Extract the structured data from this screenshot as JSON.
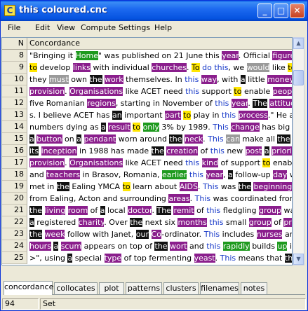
{
  "window": {
    "title": "this coloured.cnc",
    "app_icon_letter": "C"
  },
  "titlebar_buttons": {
    "minimize": "_",
    "maximize": "□",
    "close": "✕"
  },
  "menu": [
    "File",
    "Edit",
    "View",
    "Compute",
    "Settings",
    "Help"
  ],
  "grid": {
    "col_n": "N",
    "col_c": "Concordance",
    "rows": [
      {
        "n": "8",
        "segs": [
          [
            "t",
            "\"Bringing it "
          ],
          [
            "green",
            "Home"
          ],
          [
            "t",
            "\" was published on 21 June this "
          ],
          [
            "purple",
            "year"
          ],
          [
            "t",
            ". Official "
          ],
          [
            "purple",
            "figures"
          ],
          [
            "t",
            " sug"
          ]
        ]
      },
      {
        "n": "9",
        "segs": [
          [
            "yellow",
            "to"
          ],
          [
            "t",
            " develop "
          ],
          [
            "purple",
            "links"
          ],
          [
            "t",
            " with individual "
          ],
          [
            "purple",
            "churches"
          ],
          [
            "t",
            ". "
          ],
          [
            "yellow",
            "To"
          ],
          [
            "t",
            " "
          ],
          [
            "blue",
            "do this"
          ],
          [
            "t",
            ", we "
          ],
          [
            "gray",
            "would"
          ],
          [
            "t",
            " like "
          ],
          [
            "yellow",
            "to"
          ],
          [
            "t",
            " recruit"
          ]
        ]
      },
      {
        "n": "10",
        "segs": [
          [
            "t",
            "they "
          ],
          [
            "gray",
            "must"
          ],
          [
            "t",
            " own "
          ],
          [
            "black",
            "the"
          ],
          [
            "t",
            " "
          ],
          [
            "purple",
            "work"
          ],
          [
            "t",
            " themselves. In "
          ],
          [
            "blue",
            "this"
          ],
          [
            "t",
            " "
          ],
          [
            "purple",
            "way"
          ],
          [
            "t",
            ", with "
          ],
          [
            "black",
            "a"
          ],
          [
            "t",
            " little "
          ],
          [
            "purple",
            "money"
          ]
        ]
      },
      {
        "n": "11",
        "segs": [
          [
            "purple",
            "provision"
          ],
          [
            "t",
            ". "
          ],
          [
            "purple",
            "Organisations"
          ],
          [
            "t",
            " like ACET need "
          ],
          [
            "blue",
            "this"
          ],
          [
            "t",
            " support "
          ],
          [
            "yellow",
            "to"
          ],
          [
            "t",
            " enable "
          ],
          [
            "purple",
            "people"
          ]
        ]
      },
      {
        "n": "12",
        "segs": [
          [
            "t",
            "five Romanian "
          ],
          [
            "purple",
            "regions"
          ],
          [
            "t",
            ", starting in November of "
          ],
          [
            "blue",
            "this"
          ],
          [
            "t",
            " "
          ],
          [
            "purple",
            "year"
          ],
          [
            "t",
            ". "
          ],
          [
            "black",
            "The"
          ],
          [
            "t",
            " "
          ],
          [
            "purple",
            "attitude"
          ],
          [
            "t",
            " of man"
          ]
        ]
      },
      {
        "n": "13",
        "segs": [
          [
            "t",
            "s. I believe ACET has "
          ],
          [
            "black",
            "an"
          ],
          [
            "t",
            " important "
          ],
          [
            "purple",
            "part"
          ],
          [
            "t",
            " "
          ],
          [
            "yellow",
            "to"
          ],
          [
            "t",
            " play in "
          ],
          [
            "blue",
            "this"
          ],
          [
            "t",
            " "
          ],
          [
            "purple",
            "process"
          ],
          [
            "t",
            ".\" He added, \"W"
          ]
        ]
      },
      {
        "n": "14",
        "segs": [
          [
            "t",
            "numbers dying as "
          ],
          [
            "black",
            "a"
          ],
          [
            "t",
            " "
          ],
          [
            "purple",
            "result"
          ],
          [
            "t",
            " "
          ],
          [
            "yellow",
            "to"
          ],
          [
            "t",
            " "
          ],
          [
            "green",
            "only"
          ],
          [
            "t",
            " 3% by 1989. "
          ],
          [
            "blue",
            "This"
          ],
          [
            "t",
            " "
          ],
          [
            "purple",
            "change"
          ],
          [
            "t",
            " has big "
          ],
          [
            "purple",
            "implicati"
          ]
        ]
      },
      {
        "n": "15",
        "segs": [
          [
            "black",
            "a"
          ],
          [
            "t",
            " "
          ],
          [
            "purple",
            "button"
          ],
          [
            "t",
            " on "
          ],
          [
            "black",
            "a"
          ],
          [
            "t",
            " "
          ],
          [
            "purple",
            "pendant"
          ],
          [
            "t",
            " worn around "
          ],
          [
            "black",
            "the"
          ],
          [
            "t",
            " "
          ],
          [
            "purple",
            "neck"
          ],
          [
            "t",
            ". "
          ],
          [
            "blue",
            "This"
          ],
          [
            "t",
            " "
          ],
          [
            "gray",
            "can"
          ],
          [
            "t",
            " make all "
          ],
          [
            "black",
            "the"
          ],
          [
            "t",
            " "
          ],
          [
            "purple",
            "differen"
          ]
        ]
      },
      {
        "n": "16",
        "segs": [
          [
            "black",
            "its"
          ],
          [
            "t",
            " "
          ],
          [
            "purple",
            "inception"
          ],
          [
            "t",
            " in 1988 has made "
          ],
          [
            "black",
            "the"
          ],
          [
            "t",
            " "
          ],
          [
            "purple",
            "creation"
          ],
          [
            "t",
            " of "
          ],
          [
            "blue",
            "this"
          ],
          [
            "t",
            " new "
          ],
          [
            "purple",
            "post"
          ],
          [
            "t",
            " "
          ],
          [
            "black",
            "a"
          ],
          [
            "t",
            " "
          ],
          [
            "purple",
            "priority"
          ],
          [
            "t",
            ". \"I w"
          ]
        ]
      },
      {
        "n": "17",
        "segs": [
          [
            "purple",
            "provision"
          ],
          [
            "t",
            ". "
          ],
          [
            "purple",
            "Organisations"
          ],
          [
            "t",
            " like ACET need "
          ],
          [
            "blue",
            "this"
          ],
          [
            "t",
            " "
          ],
          [
            "purple",
            "kind"
          ],
          [
            "t",
            " of support "
          ],
          [
            "yellow",
            "to"
          ],
          [
            "t",
            " enable"
          ]
        ]
      },
      {
        "n": "18",
        "segs": [
          [
            "t",
            "and "
          ],
          [
            "purple",
            "teachers"
          ],
          [
            "t",
            " in Brasov, Romania, "
          ],
          [
            "green",
            "earlier"
          ],
          [
            "t",
            " "
          ],
          [
            "blue",
            "this"
          ],
          [
            "t",
            " "
          ],
          [
            "purple",
            "year"
          ],
          [
            "t",
            ", "
          ],
          [
            "black",
            "a"
          ],
          [
            "t",
            " follow-up "
          ],
          [
            "purple",
            "day"
          ],
          [
            "t",
            " w"
          ]
        ]
      },
      {
        "n": "19",
        "segs": [
          [
            "t",
            "met in "
          ],
          [
            "black",
            "the"
          ],
          [
            "t",
            " Ealing YMCA "
          ],
          [
            "yellow",
            "to"
          ],
          [
            "t",
            " learn about "
          ],
          [
            "purple",
            "AIDS"
          ],
          [
            "t",
            ". "
          ],
          [
            "blue",
            "This"
          ],
          [
            "t",
            " was "
          ],
          [
            "black",
            "the"
          ],
          [
            "t",
            " "
          ],
          [
            "purple",
            "beginning"
          ],
          [
            "t",
            " of AC"
          ]
        ]
      },
      {
        "n": "20",
        "segs": [
          [
            "t",
            "from Ealing, Acton and surrounding "
          ],
          [
            "purple",
            "areas"
          ],
          [
            "t",
            ". "
          ],
          [
            "blue",
            "This"
          ],
          [
            "t",
            " was coordinated from "
          ],
          [
            "black",
            "th"
          ]
        ]
      },
      {
        "n": "21",
        "segs": [
          [
            "black",
            "the"
          ],
          [
            "t",
            " "
          ],
          [
            "purple",
            "living"
          ],
          [
            "t",
            " "
          ],
          [
            "purple",
            "room"
          ],
          [
            "t",
            " of "
          ],
          [
            "black",
            "a"
          ],
          [
            "t",
            " local "
          ],
          [
            "purple",
            "doctor"
          ],
          [
            "t",
            ". "
          ],
          [
            "black",
            "The"
          ],
          [
            "t",
            " "
          ],
          [
            "purple",
            "remit"
          ],
          [
            "t",
            " of "
          ],
          [
            "blue",
            "this"
          ],
          [
            "t",
            " fledgling "
          ],
          [
            "purple",
            "group"
          ],
          [
            "t",
            " was "
          ],
          [
            "yellow",
            "to"
          ],
          [
            "t",
            " p"
          ]
        ]
      },
      {
        "n": "22",
        "segs": [
          [
            "black",
            "a"
          ],
          [
            "t",
            " registered "
          ],
          [
            "purple",
            "charity"
          ],
          [
            "t",
            ". Over "
          ],
          [
            "black",
            "the"
          ],
          [
            "t",
            " next six "
          ],
          [
            "purple",
            "months"
          ],
          [
            "t",
            " "
          ],
          [
            "blue",
            "this"
          ],
          [
            "t",
            " small "
          ],
          [
            "purple",
            "group"
          ],
          [
            "t",
            " of "
          ],
          [
            "purple",
            "professio"
          ]
        ]
      },
      {
        "n": "23",
        "segs": [
          [
            "black",
            "the"
          ],
          [
            "t",
            " "
          ],
          [
            "purple",
            "week"
          ],
          [
            "t",
            " follow with Janet, "
          ],
          [
            "black",
            "our"
          ],
          [
            "t",
            " "
          ],
          [
            "purple",
            "Co"
          ],
          [
            "t",
            "-ordinator. "
          ],
          [
            "blue",
            "This"
          ],
          [
            "t",
            " includes "
          ],
          [
            "purple",
            "nurses"
          ],
          [
            "t",
            " and "
          ],
          [
            "purple",
            "vol"
          ]
        ]
      },
      {
        "n": "24",
        "segs": [
          [
            "purple",
            "hours"
          ],
          [
            "t",
            " "
          ],
          [
            "black",
            "a"
          ],
          [
            "t",
            " "
          ],
          [
            "purple",
            "scum"
          ],
          [
            "t",
            " appears on top of "
          ],
          [
            "black",
            "the"
          ],
          [
            "t",
            " "
          ],
          [
            "purple",
            "wort"
          ],
          [
            "t",
            " and "
          ],
          [
            "blue",
            "this"
          ],
          [
            "t",
            " "
          ],
          [
            "green",
            "rapidly"
          ],
          [
            "t",
            " builds "
          ],
          [
            "green",
            "up"
          ],
          [
            "t",
            " into "
          ],
          [
            "black",
            "a"
          ],
          [
            "t",
            " "
          ],
          [
            "purple",
            "g"
          ]
        ]
      },
      {
        "n": "25",
        "segs": [
          [
            "t",
            ">\", using "
          ],
          [
            "black",
            "a"
          ],
          [
            "t",
            " special "
          ],
          [
            "purple",
            "type"
          ],
          [
            "t",
            " of top fermenting "
          ],
          [
            "purple",
            "yeast"
          ],
          [
            "t",
            ". "
          ],
          [
            "blue",
            "This"
          ],
          [
            "t",
            " means that "
          ],
          [
            "black",
            "the"
          ],
          [
            "t",
            " "
          ],
          [
            "purple",
            "yeast"
          ],
          [
            "t",
            ", en"
          ]
        ]
      }
    ]
  },
  "tabs": [
    "concordance",
    "collocates",
    "plot",
    "patterns",
    "clusters",
    "filenames",
    "notes"
  ],
  "active_tab": "concordance",
  "status": {
    "count": "94",
    "state": "Set"
  },
  "colors": {
    "title_gradient": "#0553e0",
    "highlight_purple": "#8a1e8c",
    "highlight_green": "#1e9a1e",
    "highlight_yellow": "#ffe600",
    "node_blue": "#1537c8"
  }
}
